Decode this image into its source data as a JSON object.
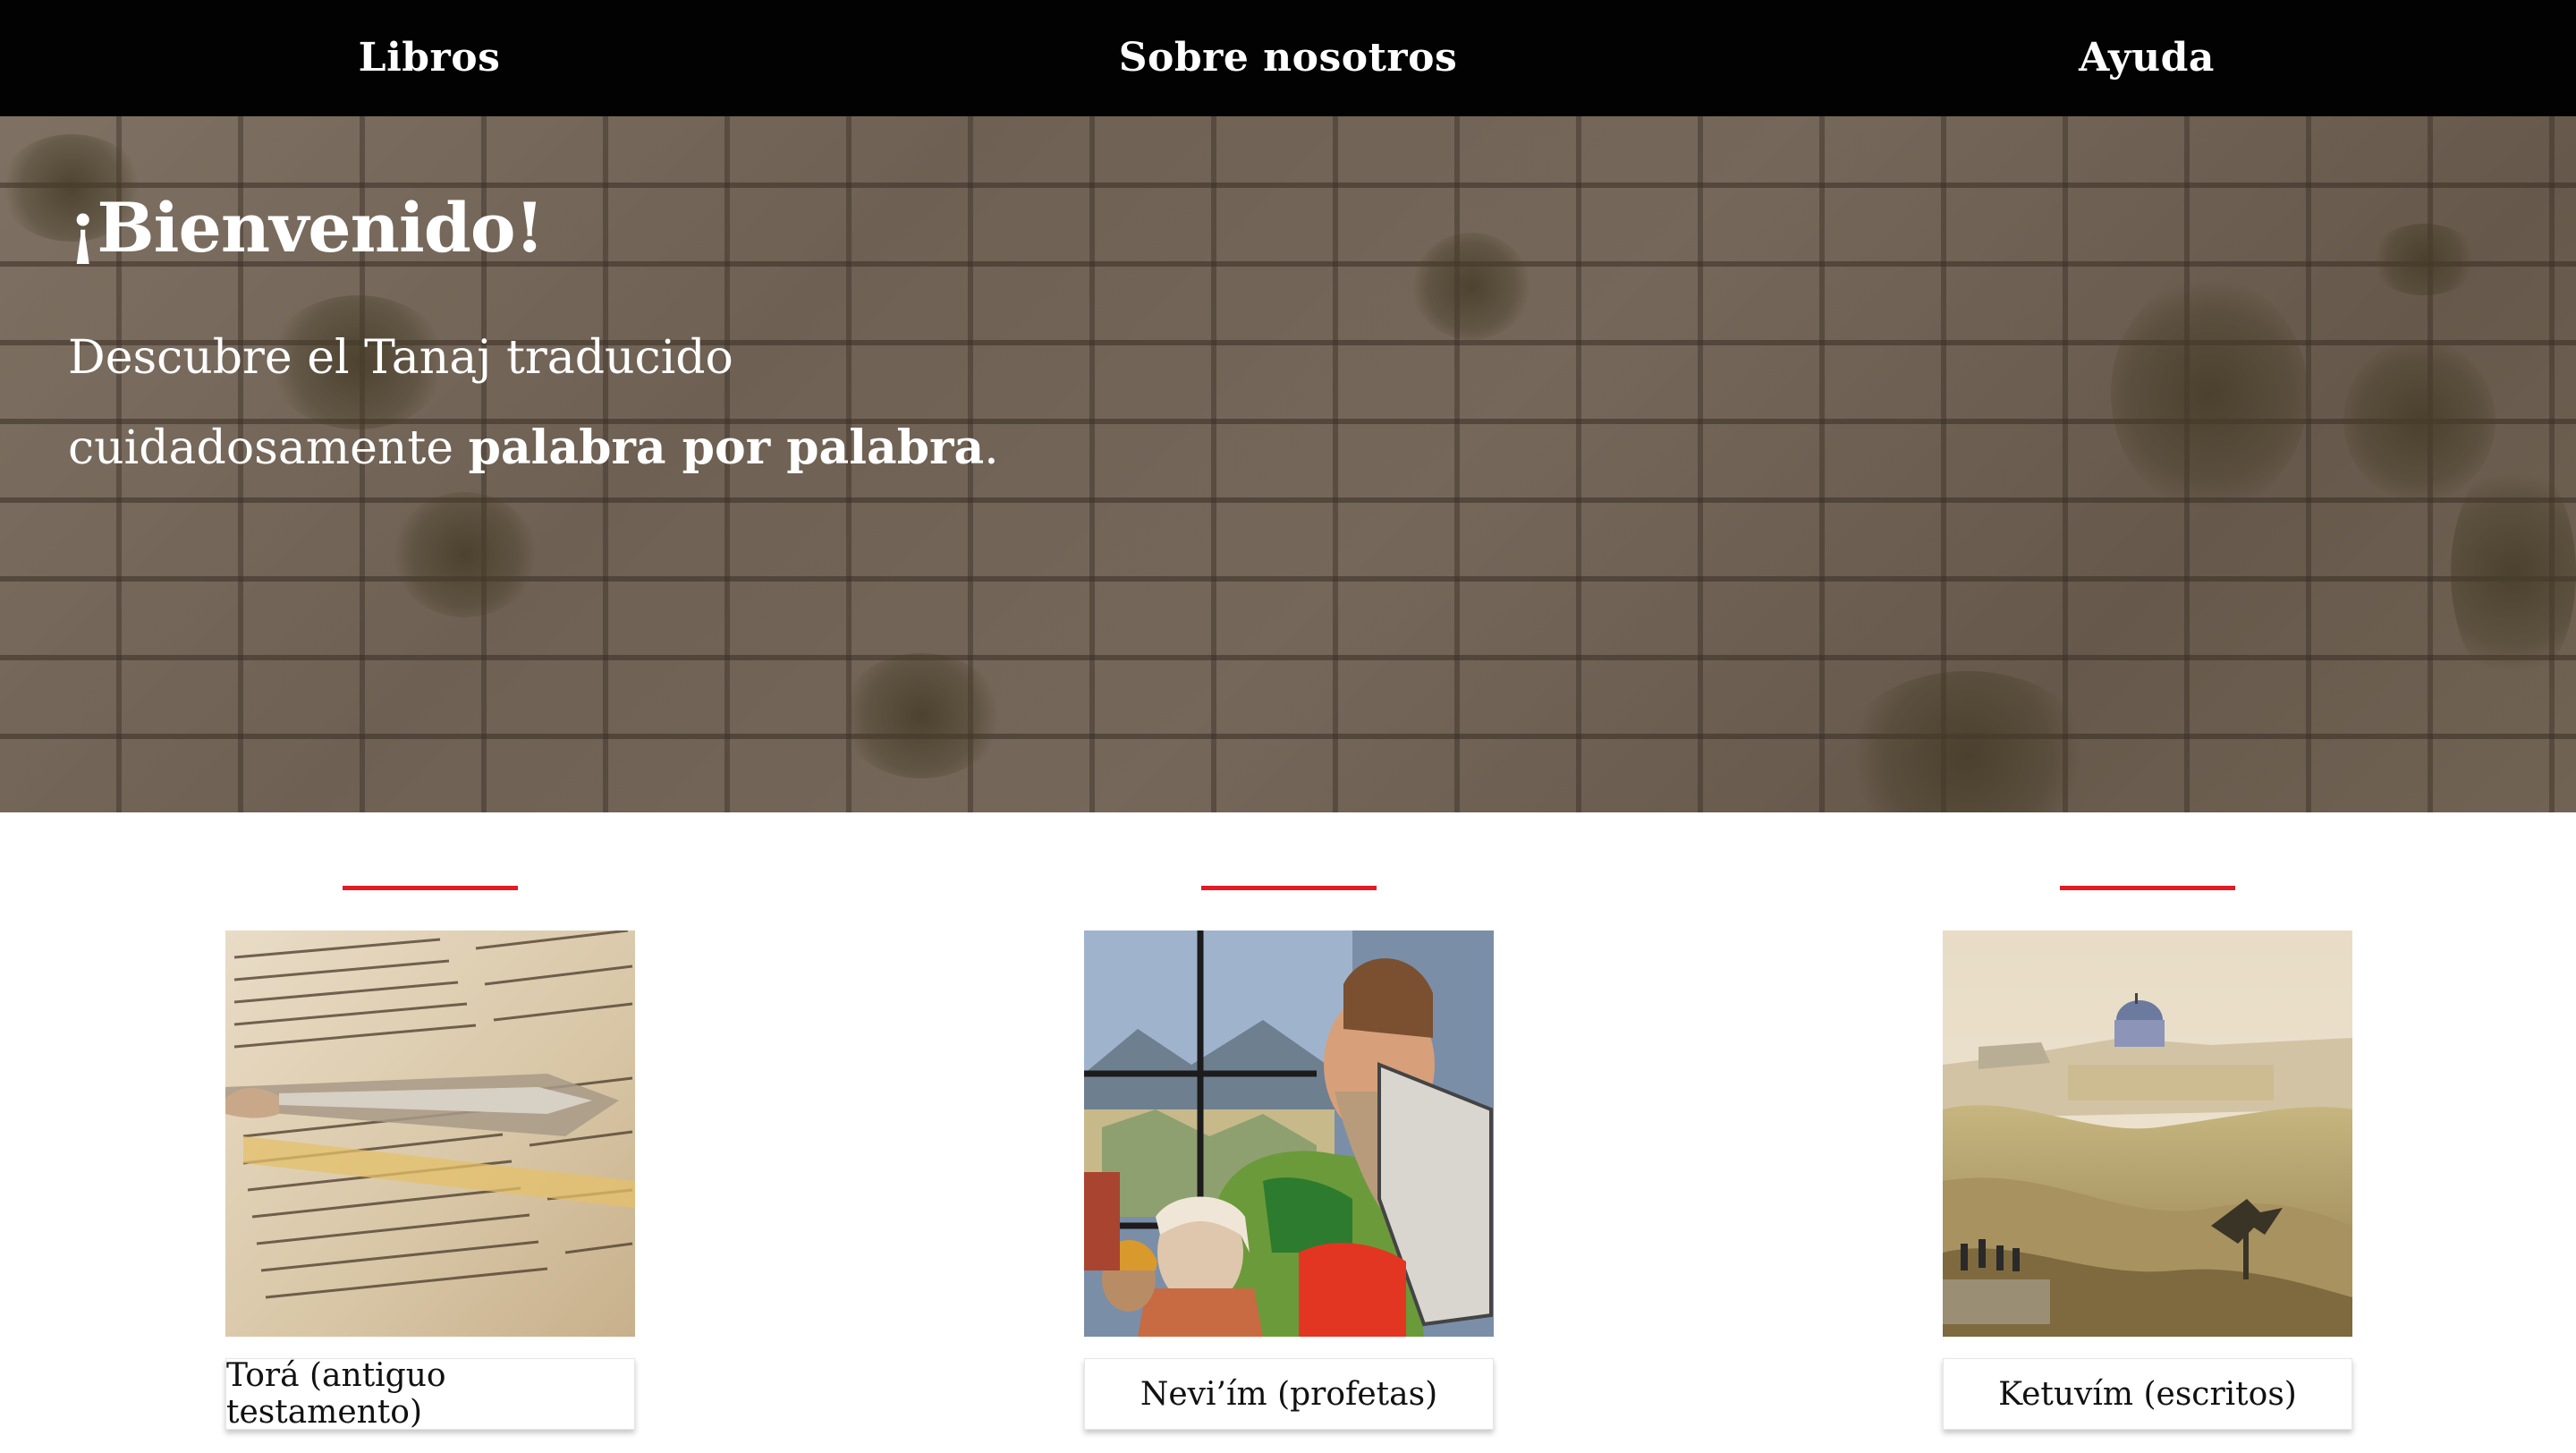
{
  "nav": {
    "items": [
      {
        "label": "Libros"
      },
      {
        "label": "Sobre nosotros"
      },
      {
        "label": "Ayuda"
      }
    ]
  },
  "hero": {
    "title": "¡Bienvenido!",
    "line1": "Descubre el Tanaj traducido",
    "line2_prefix": "cuidadosamente ",
    "line2_bold": "palabra por palabra",
    "line2_suffix": "."
  },
  "colors": {
    "nav_bg": "#020202",
    "accent": "#e31b23",
    "text_light": "#ffffff"
  },
  "cards": [
    {
      "button_label": "Torá (antiguo testamento)",
      "image": "torah-scroll-with-yad-pointer"
    },
    {
      "button_label": "Nevi’ím (profetas)",
      "image": "stained-glass-moses-tablets"
    },
    {
      "button_label": "Ketuvím (escritos)",
      "image": "jerusalem-landscape-painting"
    }
  ]
}
